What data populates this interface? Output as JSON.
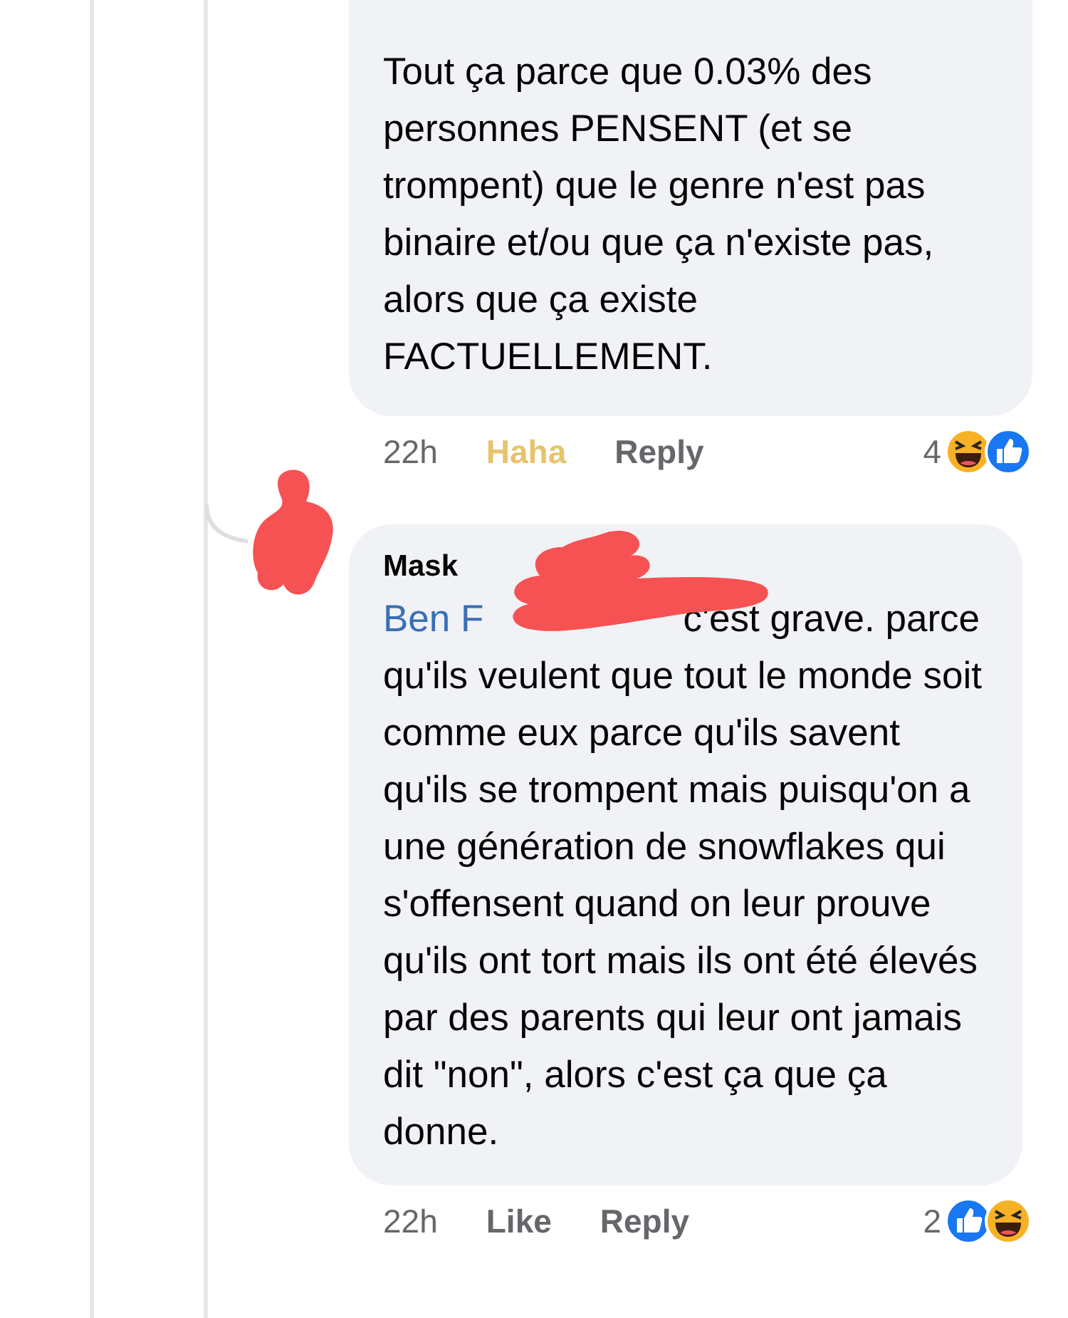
{
  "comments": [
    {
      "text": "Tout ça parce que 0.03% des personnes PENSENT (et se trompent) que le genre n'est pas binaire et/ou que ça n'existe pas, alors que ça existe FACTUELLEMENT.",
      "time": "22h",
      "actions": [
        {
          "label": "Haha",
          "selected": true
        },
        {
          "label": "Reply",
          "selected": false
        }
      ],
      "reaction_count": "4",
      "reactions": [
        {
          "kind": "haha"
        },
        {
          "kind": "like"
        }
      ]
    },
    {
      "author": "Mask",
      "mention": "Ben F",
      "text": "c'est grave. parce qu'ils veulent que tout le monde soit comme eux parce qu'ils savent qu'ils se trompent mais puisqu'on a une génération de snowflakes qui s'offensent quand on leur prouve qu'ils ont tort mais ils ont été élevés par des parents qui leur ont jamais dit \"non\", alors c'est ça que ça donne.",
      "time": "22h",
      "actions": [
        {
          "label": "Like",
          "selected": false
        },
        {
          "label": "Reply",
          "selected": false
        }
      ],
      "reaction_count": "2",
      "reactions": [
        {
          "kind": "like"
        },
        {
          "kind": "haha"
        }
      ]
    }
  ]
}
